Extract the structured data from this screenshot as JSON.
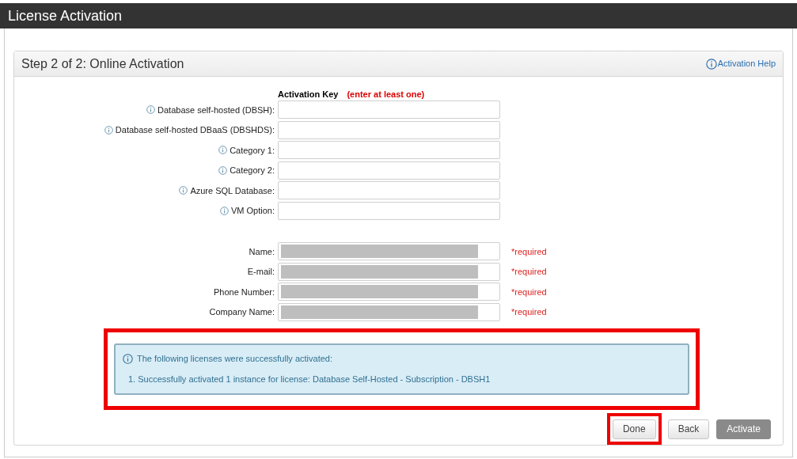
{
  "window": {
    "title": "License Activation"
  },
  "panel": {
    "title": "Step 2 of 2: Online Activation",
    "help_link": "Activation Help"
  },
  "activation_keys": {
    "heading": "Activation Key",
    "hint": "(enter at least one)",
    "fields": [
      {
        "label": "Database self-hosted (DBSH):"
      },
      {
        "label": "Database self-hosted DBaaS (DBSHDS):"
      },
      {
        "label": "Category 1:"
      },
      {
        "label": "Category 2:"
      },
      {
        "label": "Azure SQL Database:"
      },
      {
        "label": "VM Option:"
      }
    ]
  },
  "contact_fields": [
    {
      "label": "Name:",
      "redacted": true,
      "note": "*required"
    },
    {
      "label": "E-mail:",
      "redacted": true,
      "note": "*required"
    },
    {
      "label": "Phone Number:",
      "redacted": true,
      "note": "*required"
    },
    {
      "label": "Company Name:",
      "redacted": true,
      "note": "*required"
    }
  ],
  "alert": {
    "highlighted": true,
    "message": "The following licenses were successfully activated:",
    "items": [
      "1. Successfully activated 1 instance for license: Database Self-Hosted - Subscription - DBSH1"
    ]
  },
  "buttons": [
    {
      "label": "Done",
      "highlighted": true,
      "disabled": false
    },
    {
      "label": "Back",
      "highlighted": false,
      "disabled": false
    },
    {
      "label": "Activate",
      "highlighted": false,
      "disabled": true
    }
  ]
}
